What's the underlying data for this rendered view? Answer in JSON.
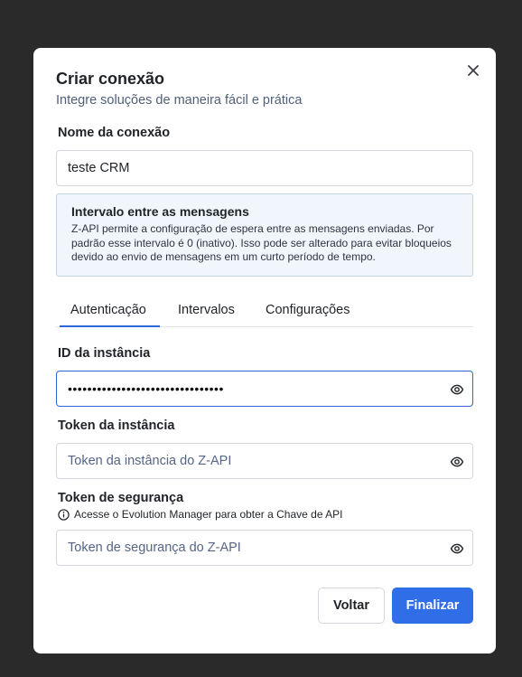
{
  "modal": {
    "title": "Criar conexão",
    "subtitle": "Integre soluções de maneira fácil e prática"
  },
  "connection_name": {
    "label": "Nome da conexão",
    "value": "teste CRM"
  },
  "info_box": {
    "title": "Intervalo entre as mensagens",
    "body": "Z-API permite a configuração de espera entre as mensagens enviadas. Por padrão esse intervalo é 0 (inativo). Isso pode ser alterado para evitar bloqueios devido ao envio de mensagens em um curto período de tempo."
  },
  "tabs": [
    {
      "label": "Autenticação",
      "active": true
    },
    {
      "label": "Intervalos",
      "active": false
    },
    {
      "label": "Configurações",
      "active": false
    }
  ],
  "instance_id": {
    "label": "ID da instância",
    "masked_value": "••••••••••••••••••••••••••••••••"
  },
  "instance_token": {
    "label": "Token da instância",
    "placeholder": "Token da instância do Z-API"
  },
  "security_token": {
    "label": "Token de segurança",
    "hint": "Acesse o Evolution Manager para obter a Chave de API",
    "placeholder": "Token de segurança do Z-API"
  },
  "buttons": {
    "back": "Voltar",
    "finish": "Finalizar"
  },
  "colors": {
    "accent": "#2f6ee6",
    "info_bg": "#f1f6fd",
    "overlay": "#2a2a2a"
  },
  "icons": [
    "close-icon",
    "eye-icon",
    "info-icon"
  ]
}
